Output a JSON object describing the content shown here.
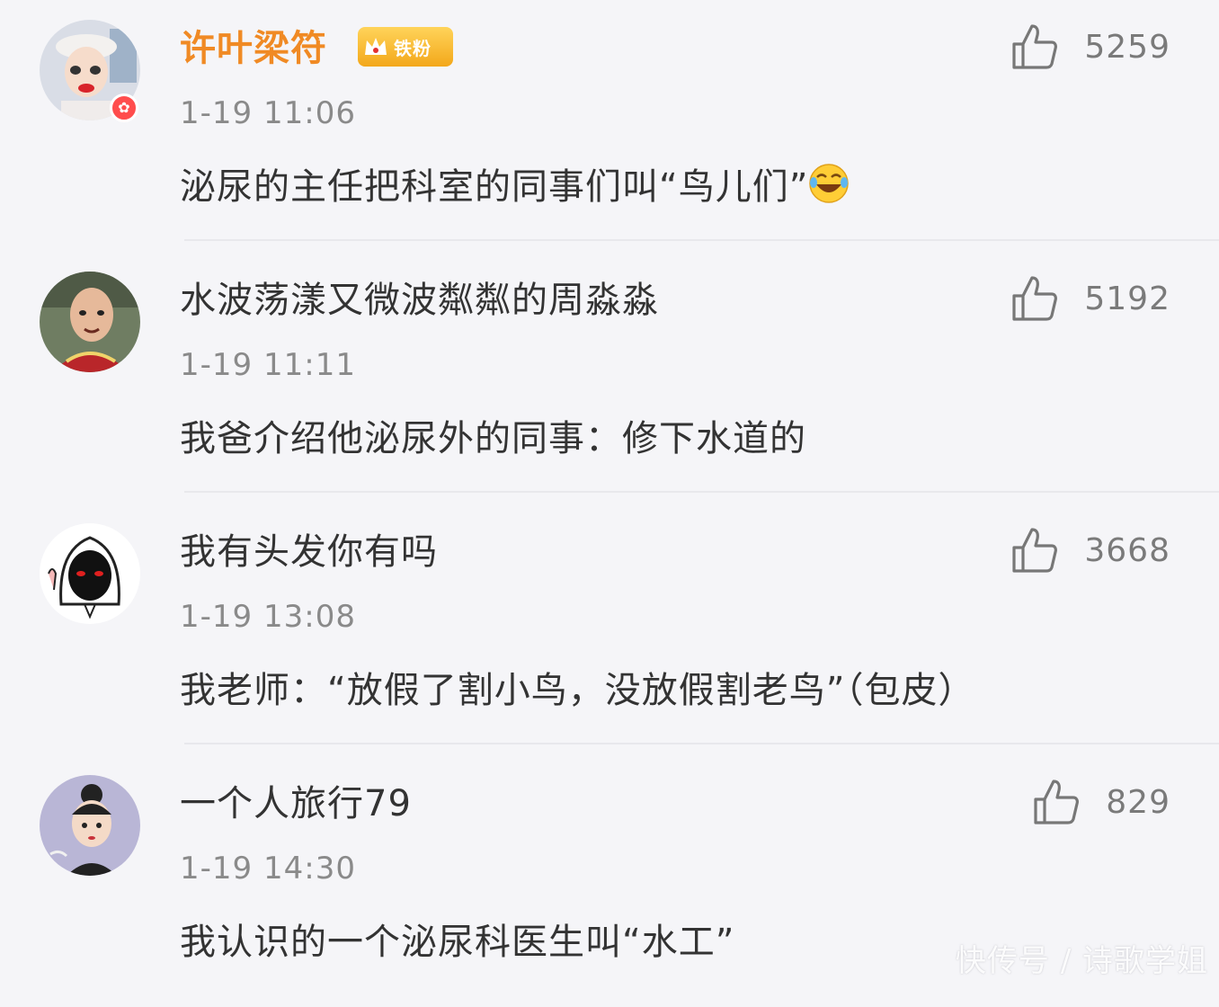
{
  "comments": [
    {
      "username": "许叶梁符",
      "fan_badge": "铁粉",
      "time": "1-19 11:06",
      "content": "泌尿的主任把科室的同事们叫“鸟儿们”",
      "likes": "5259",
      "avatar_icon": "avatar-woman-beret",
      "emoji": "laugh-cry-emoji"
    },
    {
      "username": "水波荡漾又微波粼粼的周淼淼",
      "time": "1-19 11:11",
      "content": "我爸介绍他泌尿外的同事：修下水道的",
      "likes": "5192",
      "avatar_icon": "avatar-bald-man"
    },
    {
      "username": "我有头发你有吗",
      "time": "1-19 13:08",
      "content": "我老师：“放假了割小鸟，没放假割老鸟”（包皮）",
      "likes": "3668",
      "avatar_icon": "avatar-hooded-figure"
    },
    {
      "username": "一个人旅行79",
      "time": "1-19 14:30",
      "content": "我认识的一个泌尿科医生叫“水工”",
      "likes": "829",
      "avatar_icon": "avatar-cartoon-girl"
    }
  ],
  "watermark": "快传号 / 诗歌学姐",
  "colors": {
    "background": "#f5f5f8",
    "vip_name": "#f08a24",
    "text": "#333333",
    "meta": "#8a8a8a"
  }
}
